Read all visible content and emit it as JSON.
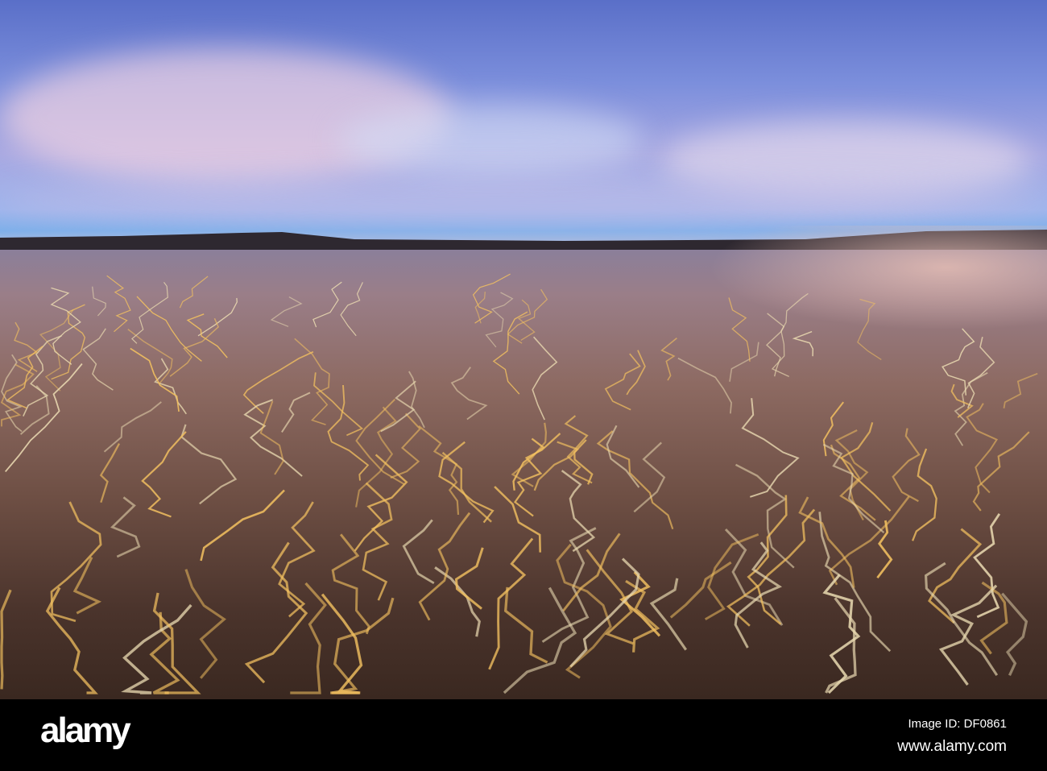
{
  "photo": {
    "description_hidden": false,
    "watermark": "alamy"
  },
  "footer": {
    "logo": "alamy",
    "image_id": "Image ID: DF0861",
    "url": "www.alamy.com"
  }
}
